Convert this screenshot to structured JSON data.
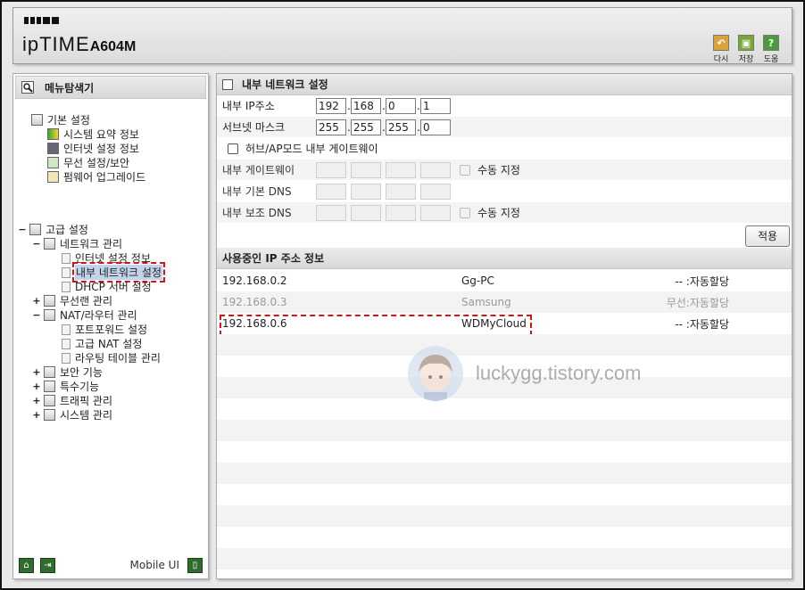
{
  "header": {
    "logo_brand": "ipTIME",
    "logo_model": "A604M",
    "buttons": [
      {
        "label": "다시",
        "icon": "undo-icon",
        "color": "#d9a33a"
      },
      {
        "label": "저장",
        "icon": "save-icon",
        "color": "#7aa836"
      },
      {
        "label": "도움",
        "icon": "help-icon",
        "color": "#4c9a3e"
      }
    ]
  },
  "sidebar": {
    "title": "메뉴탐색기",
    "basic": {
      "label": "기본 설정",
      "items": [
        "시스템 요약 정보",
        "인터넷 설정 정보",
        "무선 설정/보안",
        "펌웨어 업그레이드"
      ]
    },
    "advanced": {
      "label": "고급 설정",
      "toggle": "−",
      "network": {
        "label": "네트워크 관리",
        "toggle": "−",
        "items": [
          "인터넷 설정 정보",
          "내부 네트워크 설정",
          "DHCP 서버 설정"
        ]
      },
      "wireless": {
        "label": "무선랜 관리",
        "toggle": "+"
      },
      "nat": {
        "label": "NAT/라우터 관리",
        "toggle": "−",
        "items": [
          "포트포워드 설정",
          "고급 NAT 설정",
          "라우팅 테이블 관리"
        ]
      },
      "others": [
        {
          "label": "보안 기능",
          "toggle": "+"
        },
        {
          "label": "특수기능",
          "toggle": "+"
        },
        {
          "label": "트래픽 관리",
          "toggle": "+"
        },
        {
          "label": "시스템 관리",
          "toggle": "+"
        }
      ]
    },
    "mobile_ui": "Mobile UI"
  },
  "main": {
    "title": "내부 네트워크 설정",
    "fields": {
      "ip_label": "내부 IP주소",
      "ip": [
        "192",
        "168",
        "0",
        "1"
      ],
      "mask_label": "서브넷 마스크",
      "mask": [
        "255",
        "255",
        "255",
        "0"
      ],
      "hub_mode_label": "허브/AP모드 내부 게이트웨이",
      "gateway_label": "내부 게이트웨이",
      "dns1_label": "내부 기본 DNS",
      "dns2_label": "내부 보조 DNS",
      "manual_label": "수동 지정"
    },
    "apply_label": "적용",
    "ip_table": {
      "title": "사용중인 IP 주소 정보",
      "rows": [
        {
          "ip": "192.168.0.2",
          "name": "Gg-PC",
          "status": "-- :자동할당",
          "offline": false
        },
        {
          "ip": "192.168.0.3",
          "name": "Samsung",
          "status": "무선:자동할당",
          "offline": true
        },
        {
          "ip": "192.168.0.6",
          "name": "WDMyCloud",
          "status": "-- :자동할당",
          "offline": false
        }
      ]
    },
    "watermark": "luckygg.tistory.com"
  }
}
